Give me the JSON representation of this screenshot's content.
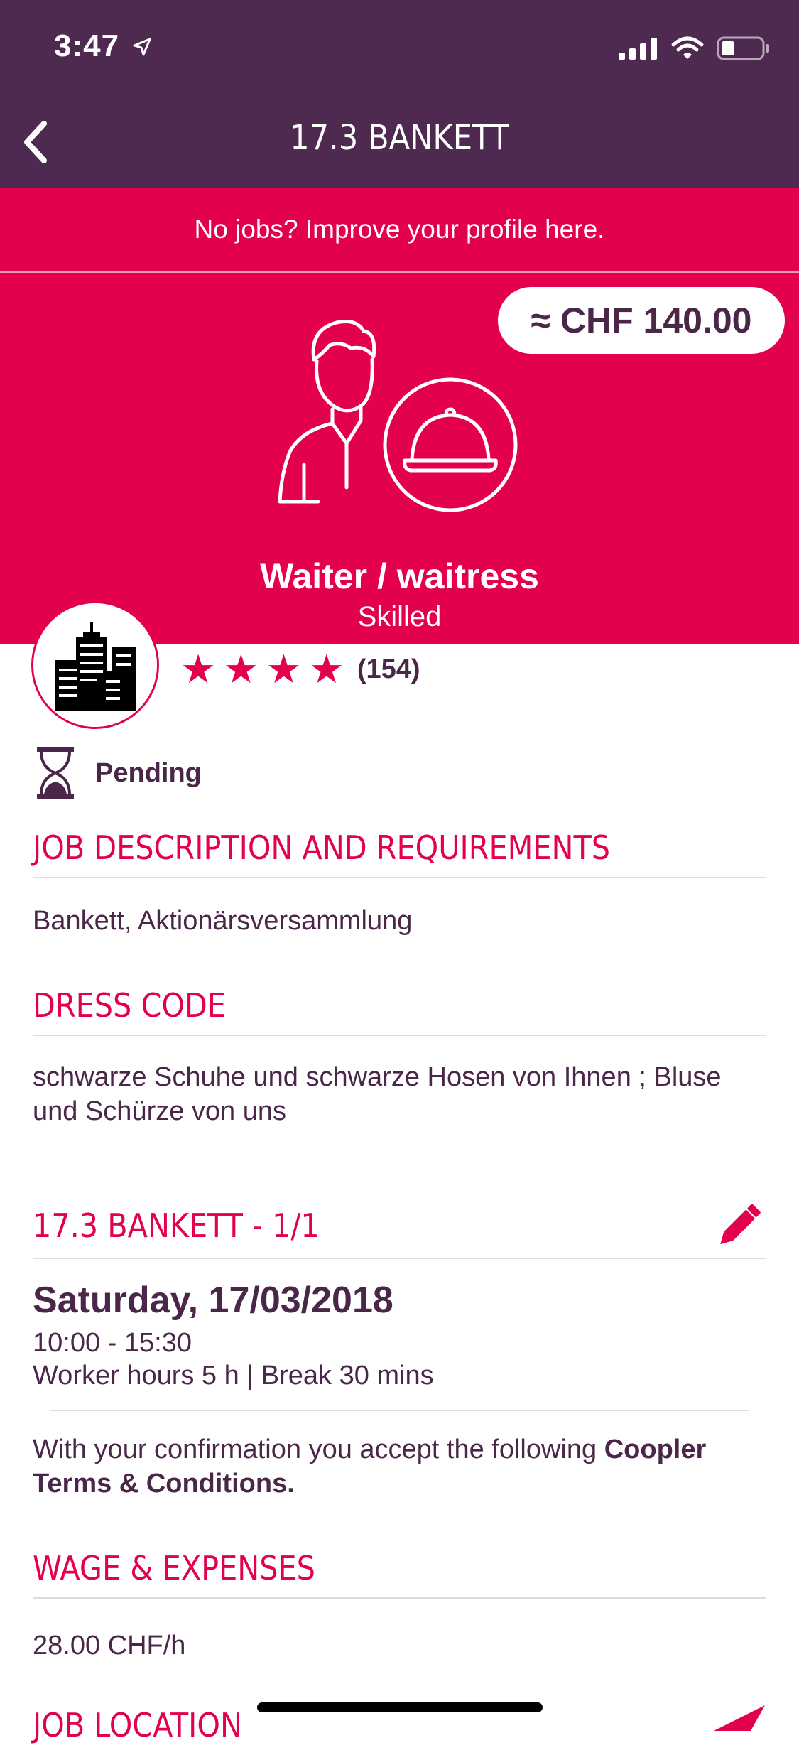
{
  "status_bar": {
    "time": "3:47"
  },
  "nav": {
    "title": "17.3 BANKETT"
  },
  "banner": {
    "text": "No jobs? Improve your profile here."
  },
  "hero": {
    "price": "≈ CHF 140.00",
    "role": "Waiter / waitress",
    "level": "Skilled"
  },
  "employer": {
    "rating": 4,
    "rating_count": "(154)"
  },
  "status": {
    "label": "Pending"
  },
  "sections": {
    "job_desc": {
      "title": "JOB DESCRIPTION AND REQUIREMENTS",
      "text": "Bankett, Aktionärsversammlung"
    },
    "dress_code": {
      "title": "DRESS CODE",
      "text": "schwarze Schuhe und schwarze Hosen von Ihnen ; Bluse und Schürze von uns"
    },
    "shift": {
      "title": "17.3 BANKETT - 1/1",
      "date": "Saturday, 17/03/2018",
      "time": "10:00 - 15:30",
      "hours": "Worker hours 5 h | Break 30 mins",
      "terms_prefix": "With your confirmation you accept the following ",
      "terms_link": "Coopler Terms & Conditions."
    },
    "wage": {
      "title": "WAGE & EXPENSES",
      "text": "28.00 CHF/h"
    },
    "location": {
      "title": "JOB LOCATION"
    }
  },
  "colors": {
    "brand_purple": "#4e2a50",
    "accent": "#e2004f",
    "text": "#4a2749"
  },
  "icons": [
    "location-arrow-icon",
    "signal-icon",
    "wifi-icon",
    "battery-icon",
    "back-chevron-icon",
    "waiter-icon",
    "building-icon",
    "hourglass-icon",
    "pencil-icon",
    "navigation-arrow-icon"
  ]
}
